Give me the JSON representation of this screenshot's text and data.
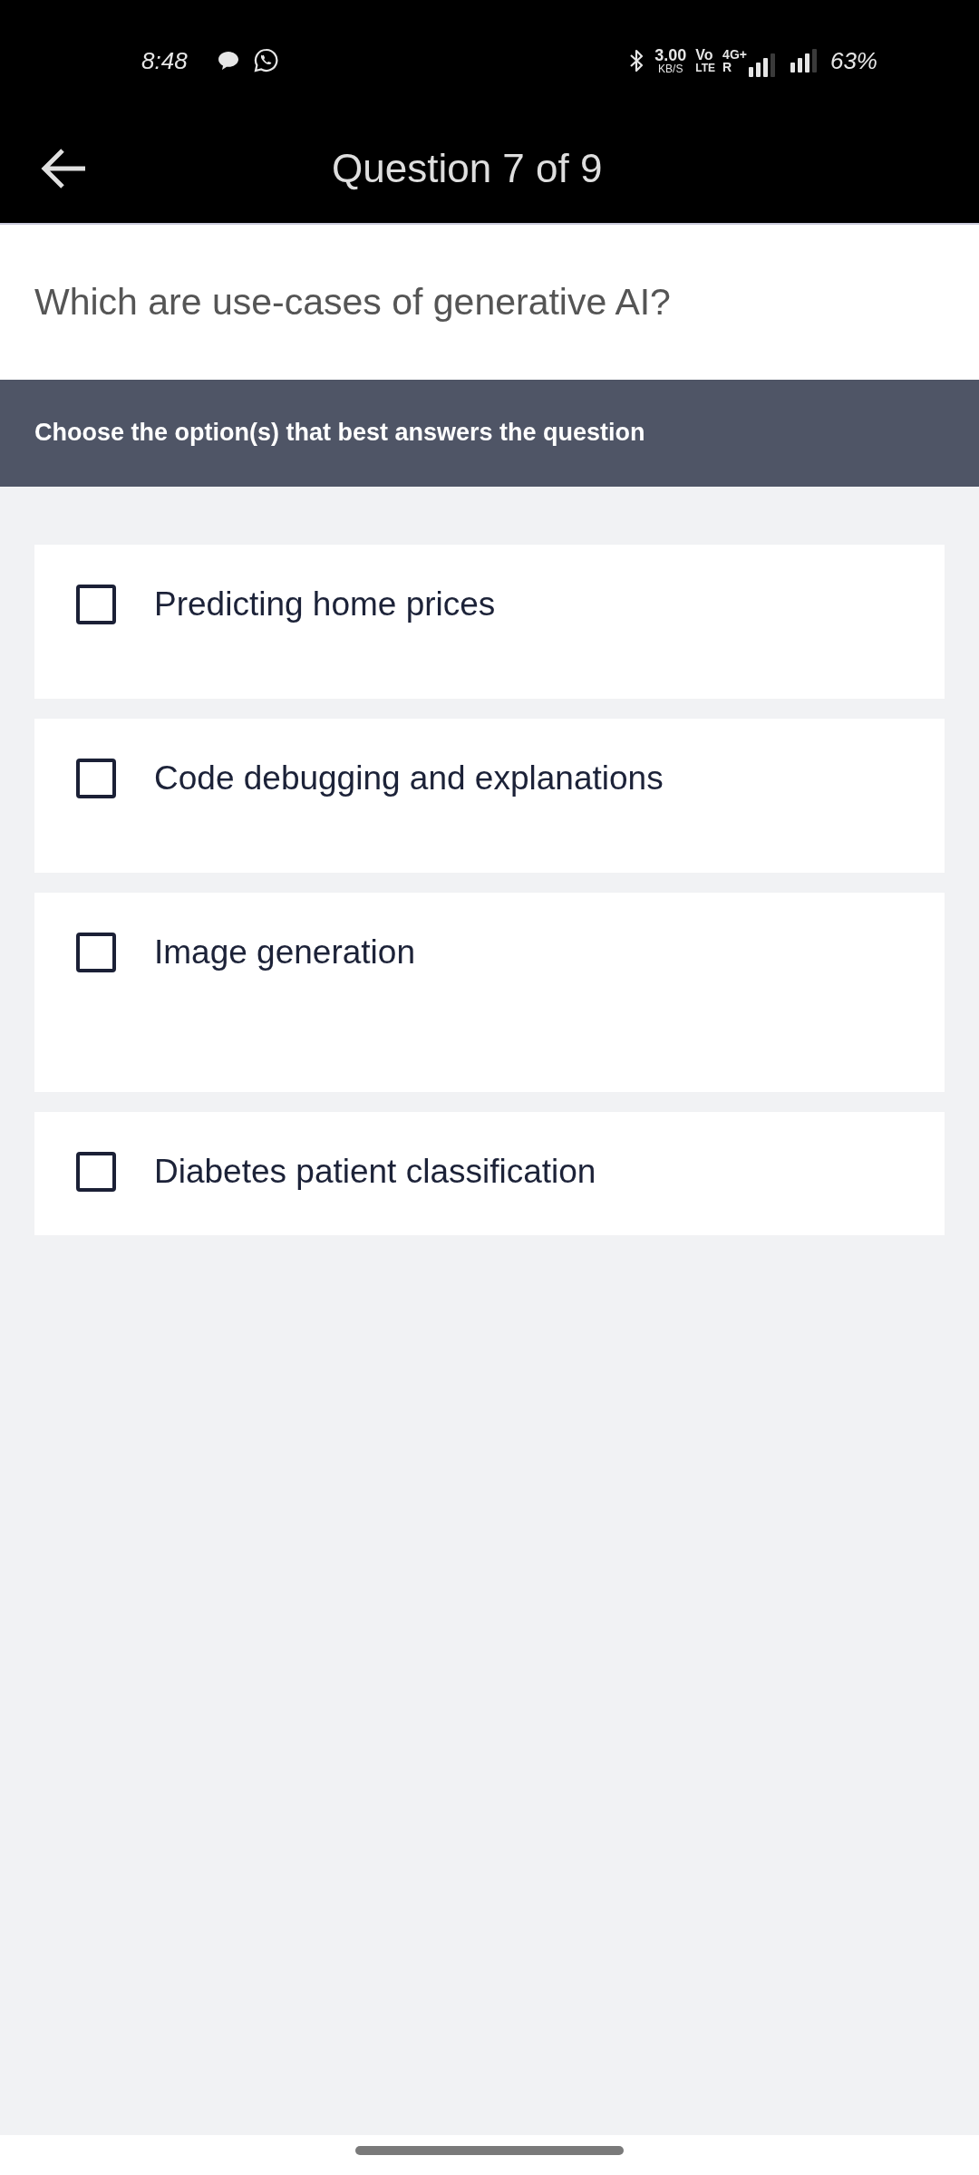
{
  "status_bar": {
    "time": "8:48",
    "speed_value": "3.00",
    "speed_unit": "KB/S",
    "volte_top": "Vo",
    "volte_bottom": "LTE",
    "network_type": "4G+",
    "roaming": "R",
    "battery": "63%"
  },
  "app_bar": {
    "title": "Question 7 of 9"
  },
  "question": {
    "text": "Which are use-cases of generative AI?"
  },
  "instruction": {
    "text": "Choose the option(s) that best answers the question"
  },
  "options": [
    {
      "label": "Predicting home prices",
      "checked": false
    },
    {
      "label": "Code debugging and explanations",
      "checked": false
    },
    {
      "label": "Image generation",
      "checked": false
    },
    {
      "label": "Diabetes patient classification",
      "checked": false
    }
  ]
}
